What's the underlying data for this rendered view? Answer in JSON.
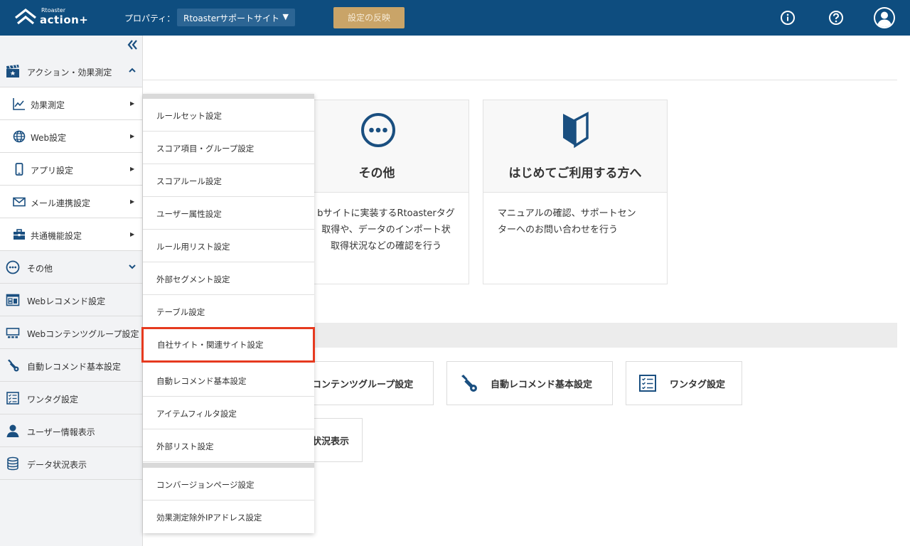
{
  "header": {
    "logo_small": "Rtoaster",
    "logo_big": "action+",
    "property_label": "プロパティ：",
    "property_value": "Rtoasterサポートサイト",
    "apply_label": "設定の反映"
  },
  "sidebar": {
    "items": [
      {
        "label": "アクション・効果測定",
        "icon": "clapperboard-icon"
      },
      {
        "label": "効果測定",
        "icon": "line-chart-icon"
      },
      {
        "label": "Web設定",
        "icon": "globe-icon"
      },
      {
        "label": "アプリ設定",
        "icon": "smartphone-icon"
      },
      {
        "label": "メール連携設定",
        "icon": "mail-icon"
      },
      {
        "label": "共通機能設定",
        "icon": "briefcase-icon"
      },
      {
        "label": "その他",
        "icon": "more-circle-icon"
      },
      {
        "label": "Webレコメンド設定",
        "icon": "web-recommend-icon"
      },
      {
        "label": "Webコンテンツグループ設定",
        "icon": "content-group-icon"
      },
      {
        "label": "自動レコメンド基本設定",
        "icon": "wrench-icon"
      },
      {
        "label": "ワンタグ設定",
        "icon": "checklist-icon"
      },
      {
        "label": "ユーザー情報表示",
        "icon": "user-icon"
      },
      {
        "label": "データ状況表示",
        "icon": "database-icon"
      }
    ]
  },
  "dropdown": {
    "items": [
      "ルールセット設定",
      "スコア項目・グループ設定",
      "スコアルール設定",
      "ユーザー属性設定",
      "ルール用リスト設定",
      "外部セグメント設定",
      "テーブル設定",
      "自社サイト・関連サイト設定",
      "自動レコメンド基本設定",
      "アイテムフィルタ設定",
      "外部リスト設定",
      "コンバージョンページ設定",
      "効果測定除外IPアドレス設定"
    ]
  },
  "cards": [
    {
      "title": "その他",
      "desc": [
        "bサイトに実装するRtoasterタグ",
        "取得や、データのインポート状",
        "取得状況などの確認を行う"
      ],
      "icon": "more-circle-icon"
    },
    {
      "title": "はじめてご利用する方へ",
      "desc": [
        "マニュアルの確認、サポートセン",
        "ターへのお問い合わせを行う"
      ],
      "icon": "beginner-mark-icon"
    }
  ],
  "tiles": [
    {
      "label": "コンテンツグループ設定"
    },
    {
      "label": "自動レコメンド基本設定",
      "icon": "wrench-icon"
    },
    {
      "label": "ワンタグ設定",
      "icon": "checklist-icon"
    },
    {
      "label": "状況表示"
    }
  ],
  "colors": {
    "header_bg": "#0e4d7f",
    "apply_bg": "#c9a468",
    "icon_blue": "#1a4f80",
    "highlight": "#e63a1f"
  }
}
